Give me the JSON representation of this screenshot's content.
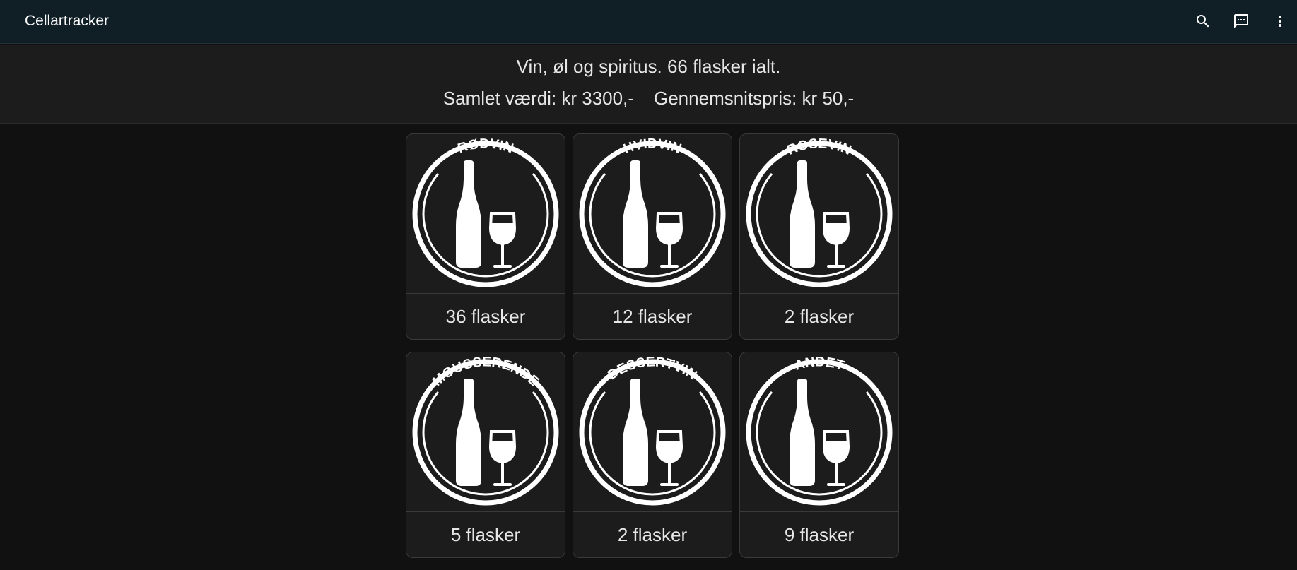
{
  "header": {
    "title": "Cellartracker",
    "icons": [
      "search-icon",
      "feedback-icon",
      "more-vert-icon"
    ]
  },
  "summary": {
    "line1": "Vin, øl og spiritus. 66 flasker ialt.",
    "total_value": "Samlet værdi: kr 3300,-",
    "average_price": "Gennemsnitspris: kr 50,-"
  },
  "categories": [
    {
      "label": "RØDVIN",
      "count_text": "36 flasker"
    },
    {
      "label": "HVIDVIN",
      "count_text": "12 flasker"
    },
    {
      "label": "ROSÉVIN",
      "count_text": "2 flasker"
    },
    {
      "label": "MOUSSERENDE",
      "count_text": "5 flasker"
    },
    {
      "label": "DESSERTVIN",
      "count_text": "2 flasker"
    },
    {
      "label": "ANDET",
      "count_text": "9 flasker"
    }
  ],
  "colors": {
    "topbar": "#101e26",
    "background": "#111111",
    "card": "#1c1c1c",
    "icon": "#ffffff"
  }
}
